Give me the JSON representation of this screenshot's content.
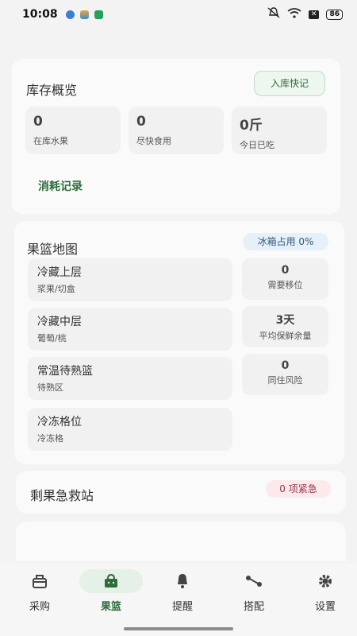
{
  "status_bar": {
    "time": "10:08",
    "battery": "86",
    "x_badge": "✕"
  },
  "inventory": {
    "title": "库存概览",
    "add_button": "入库快记",
    "stats": [
      {
        "value": "0",
        "label": "在库水果"
      },
      {
        "value": "0",
        "label": "尽快食用"
      },
      {
        "value": "0斤",
        "label": "今日已吃"
      }
    ],
    "consume_link": "消耗记录"
  },
  "basket_map": {
    "title": "果篮地图",
    "fridge_pill": "冰箱占用 0%",
    "zones": [
      {
        "name": "冷藏上层",
        "sub": "浆果/切盒"
      },
      {
        "name": "冷藏中层",
        "sub": "葡萄/桃"
      },
      {
        "name": "常温待熟篮",
        "sub": "待熟区"
      },
      {
        "name": "冷冻格位",
        "sub": "冷冻格"
      }
    ],
    "stats": [
      {
        "value": "0",
        "label": "需要移位"
      },
      {
        "value": "3天",
        "label": "平均保鲜余量"
      },
      {
        "value": "0",
        "label": "同住风险"
      }
    ]
  },
  "rescue": {
    "title": "剩果急救站",
    "urgent_pill": "0 项紧急"
  },
  "bottom_nav": {
    "items": [
      {
        "label": "采购",
        "icon": "basket-icon"
      },
      {
        "label": "果篮",
        "icon": "shopping-bag-icon"
      },
      {
        "label": "提醒",
        "icon": "bell-icon"
      },
      {
        "label": "搭配",
        "icon": "pair-icon"
      },
      {
        "label": "设置",
        "icon": "gear-icon"
      }
    ],
    "active": "果篮"
  },
  "colors": {
    "accent": "#2f6b3d",
    "accent_bg": "#e5f1e7",
    "urgent": "#9a3445",
    "info": "#2e5c80"
  }
}
